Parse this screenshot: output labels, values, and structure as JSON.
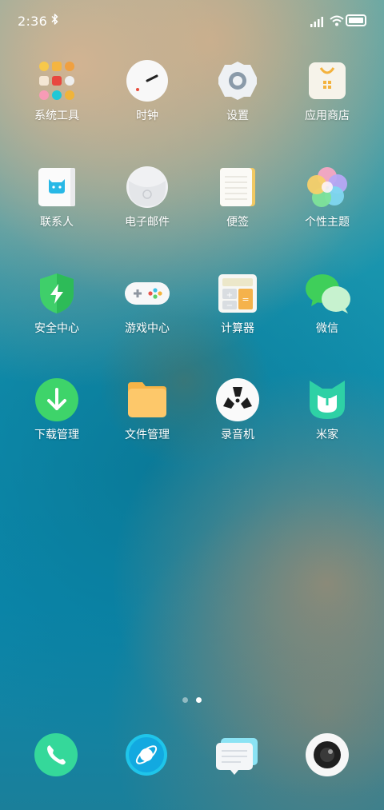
{
  "status": {
    "time": "2:36"
  },
  "apps": [
    {
      "label": "系统工具",
      "icon": "folder-icon"
    },
    {
      "label": "时钟",
      "icon": "clock-icon"
    },
    {
      "label": "设置",
      "icon": "gear-icon"
    },
    {
      "label": "应用商店",
      "icon": "app-store-icon"
    },
    {
      "label": "联系人",
      "icon": "contacts-icon"
    },
    {
      "label": "电子邮件",
      "icon": "email-icon"
    },
    {
      "label": "便签",
      "icon": "notes-icon"
    },
    {
      "label": "个性主题",
      "icon": "themes-icon"
    },
    {
      "label": "安全中心",
      "icon": "security-shield-icon"
    },
    {
      "label": "游戏中心",
      "icon": "gamepad-icon"
    },
    {
      "label": "计算器",
      "icon": "calculator-icon"
    },
    {
      "label": "微信",
      "icon": "wechat-icon"
    },
    {
      "label": "下载管理",
      "icon": "download-icon"
    },
    {
      "label": "文件管理",
      "icon": "folder-files-icon"
    },
    {
      "label": "录音机",
      "icon": "recorder-icon"
    },
    {
      "label": "米家",
      "icon": "mijia-icon"
    }
  ],
  "dock": [
    {
      "icon": "phone-icon"
    },
    {
      "icon": "browser-icon"
    },
    {
      "icon": "messages-icon"
    },
    {
      "icon": "camera-icon"
    }
  ],
  "pager": {
    "pages": 2,
    "current": 2
  }
}
